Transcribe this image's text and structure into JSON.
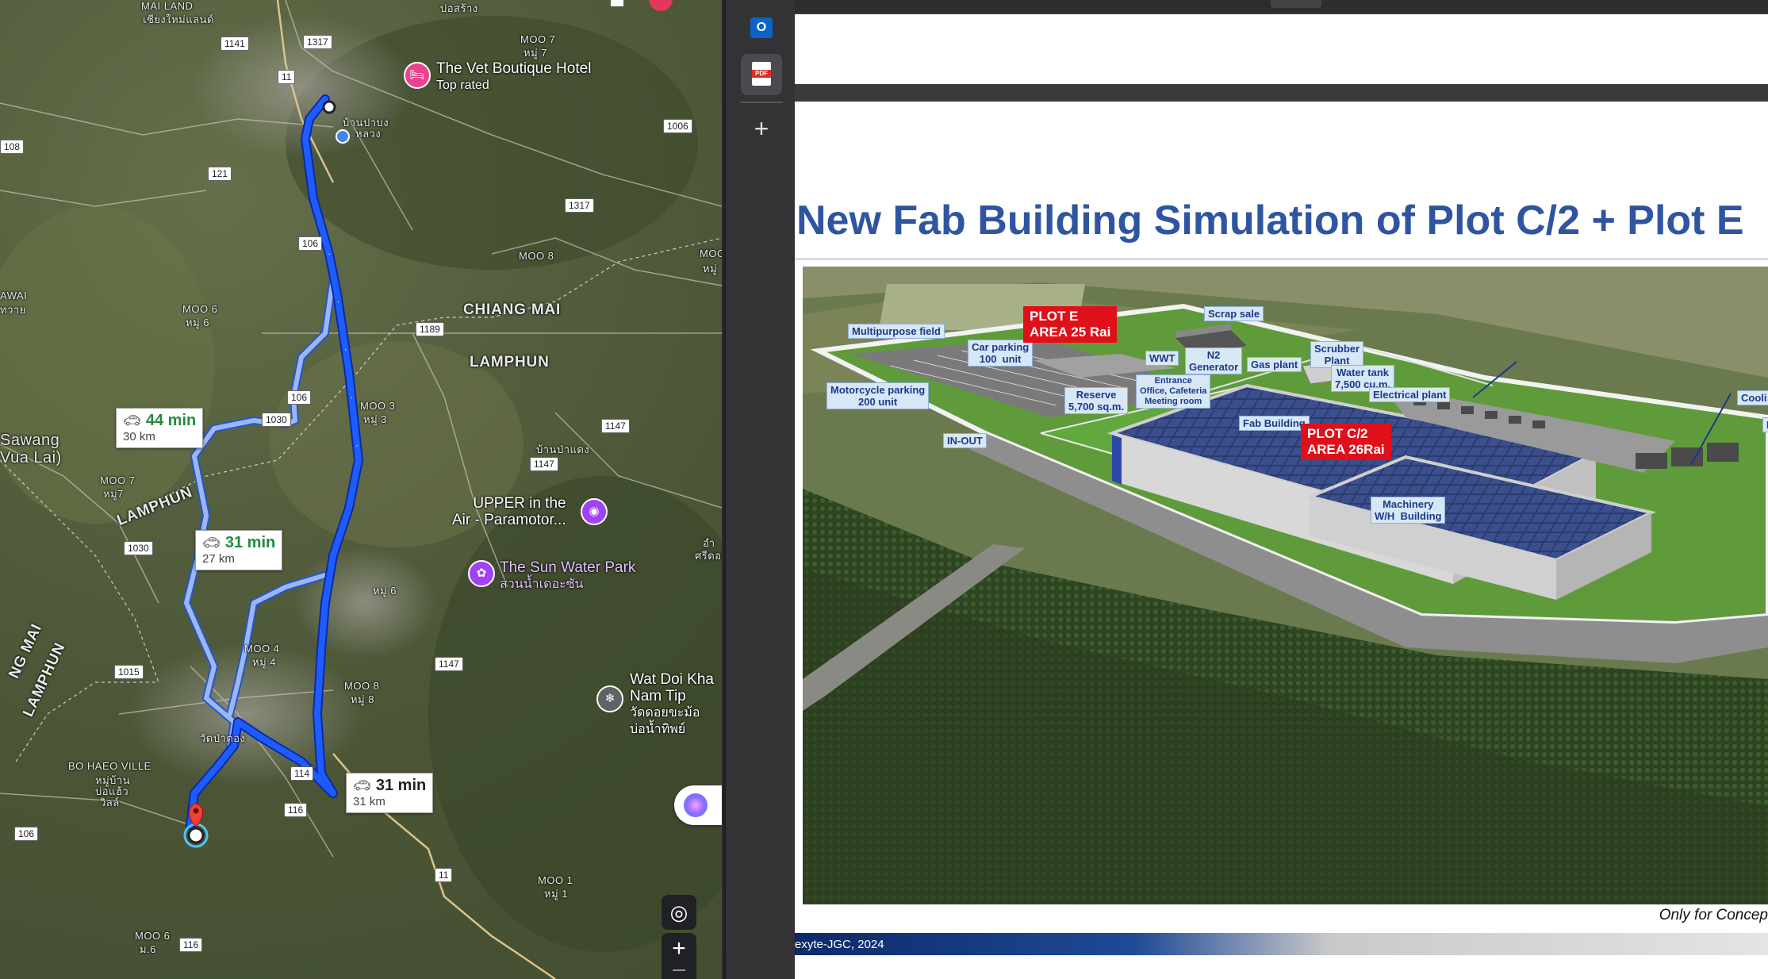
{
  "map": {
    "places": [
      "MAI LAND",
      "เชียงใหม่แลนด์",
      "บ่อสร้าง",
      "MOO 7",
      "หมู่ 7",
      "บ้านปาบง",
      "หลวง",
      "MOO 8",
      "AWAI",
      "ทวาย",
      "MOO 6",
      "หมู่ 6",
      "CHIANG MAI",
      "LAMPHUN",
      "MOO 3",
      "หมู่ 3",
      "บ้านป่าแดง",
      "Sawang",
      "Vua Lai)",
      "MOO 7",
      "หมู่7",
      "LAMPHUN",
      "หมู่ 6",
      "MOO 4",
      "หมู่ 4",
      "MOO 8",
      "หมู่ 8",
      "MOO 1",
      "หมู่ 1",
      "NG MAI",
      "LAMPHUN",
      "BO HAEO VILLE",
      "หมู่บ้าน",
      "บ่อแฮ้ว",
      "วิลล์",
      "วัดป่าตอง",
      "MOO 1",
      "หมู่ 1",
      "MOO 6",
      "ม.6",
      "MOO",
      "หมู่",
      "อำ",
      "ศรีดอน"
    ],
    "road_shields": [
      "1141",
      "1317",
      "11",
      "108",
      "121",
      "1006",
      "1317",
      "106",
      "1189",
      "106",
      "1030",
      "1147",
      "1147",
      "1030",
      "1015",
      "1147",
      "114",
      "116",
      "106",
      "11",
      "116"
    ],
    "pois": {
      "vet_hotel": {
        "name": "The Vet Boutique Hotel",
        "sub": "Top rated",
        "icon": "bed-icon",
        "color": "#e8438e"
      },
      "upper_air": {
        "name": "UPPER in the",
        "name2": "Air - Paramotor...",
        "icon": "camera-icon",
        "color": "#a142f4"
      },
      "sun_water": {
        "name": "The Sun Water Park",
        "sub": "สวนน้ำเดอะซัน",
        "icon": "park-icon",
        "color": "#a142f4"
      },
      "wat_doi": {
        "name": "Wat Doi Kha",
        "name2": "Nam Tip",
        "sub": "วัดดอยขะม้อ",
        "sub2": "บ่อน้ำทิพย์",
        "icon": "temple-icon",
        "color": "#5f6368"
      }
    },
    "routes": [
      {
        "time": "44 min",
        "distance": "30 km",
        "style": "alt"
      },
      {
        "time": "31 min",
        "distance": "27 km",
        "style": "alt"
      },
      {
        "time": "31 min",
        "distance": "31 km",
        "style": "selected"
      }
    ],
    "controls": {
      "locate": "◎",
      "zoom_in": "+",
      "zoom_out": "—"
    }
  },
  "rail": {
    "outlook_label": "O",
    "pdf_label": "PDF",
    "add_label": "+"
  },
  "pdf": {
    "title": "New Fab Building Simulation of Plot C/2 + Plot E",
    "labels": {
      "multipurpose": "Multipurpose field",
      "car_parking": "Car parking\n100  unit",
      "moto_parking": "Motorcycle parking\n200 unit",
      "in_out": "IN-OUT",
      "wwt": "WWT",
      "n2": "N2\nGenerator",
      "gas_plant": "Gas plant",
      "scrap_sale": "Scrap sale",
      "scrubber": "Scrubber\nPlant",
      "water_tank": "Water tank\n7,500 cu.m.",
      "electrical": "Electrical plant",
      "entrance": "Entrance\nOffice, Cafeteria\nMeeting room",
      "reserve": "Reserve\n5,700 sq.m.",
      "fab_building": "Fab Building",
      "machinery": "Machinery\nW/H  Building",
      "cooling": "Cooli",
      "e_cut": "E"
    },
    "plots": {
      "plot_e": "PLOT E\nAREA 25 Rai",
      "plot_c2": "PLOT C/2\nAREA 26Rai"
    },
    "disclaimer": "Only for Concep",
    "footer": "exyte-JGC, 2024"
  }
}
